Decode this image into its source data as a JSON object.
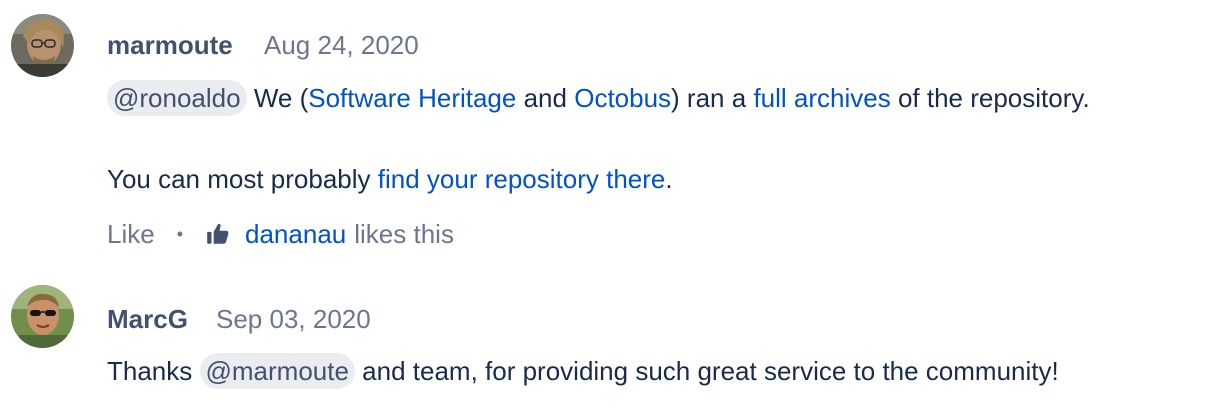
{
  "comments": [
    {
      "author": "marmoute",
      "date": "Aug 24, 2020",
      "mention": "@ronoaldo",
      "text_1": "We (",
      "link_software_heritage": "Software Heritage",
      "text_2": "and",
      "link_octobus": "Octobus",
      "text_3": ") ran a",
      "link_full_archives": "full archives",
      "text_4": "of the repository.",
      "text_5": "You can most probably",
      "link_find_repo": "find your repository there",
      "text_6": ".",
      "like_label": "Like",
      "separator": "•",
      "liked_by": "dananau",
      "likes_suffix": "likes this"
    },
    {
      "author": "MarcG",
      "date": "Sep 03, 2020",
      "text_1": "Thanks",
      "mention": "@marmoute",
      "text_2": "and team, for providing such great service to the community!"
    }
  ],
  "colors": {
    "link": "#0052cc",
    "text": "#172b4d",
    "muted": "#6b778c",
    "mention_bg": "#ebecf0"
  }
}
